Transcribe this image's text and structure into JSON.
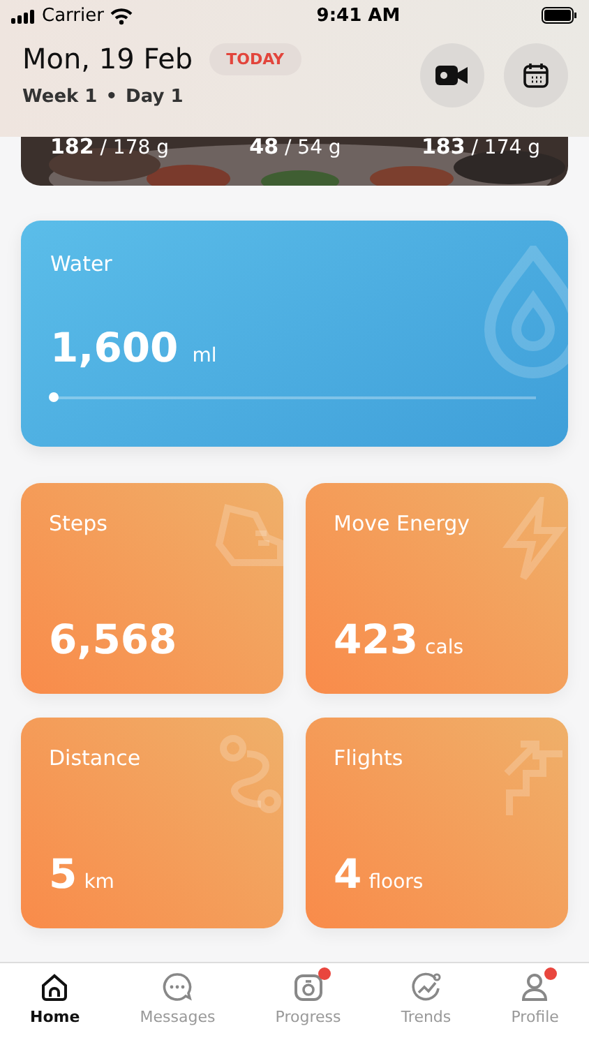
{
  "status_bar": {
    "carrier": "Carrier",
    "time": "9:41 AM"
  },
  "header": {
    "date": "Mon, 19 Feb",
    "badge": "TODAY",
    "week": "Week 1",
    "separator": "•",
    "day": "Day 1"
  },
  "meal_card": {
    "kind": "picture",
    "macros": [
      {
        "value": "182",
        "target": "/ 178 g"
      },
      {
        "value": "48",
        "target": "/ 54 g"
      },
      {
        "value": "183",
        "target": "/ 174 g"
      }
    ]
  },
  "water": {
    "title": "Water",
    "value": "1,600",
    "unit": "ml",
    "level": 0
  },
  "tiles": [
    {
      "kind": "steps",
      "title": "Steps",
      "value": "6,568"
    },
    {
      "kind": "energy",
      "title": "Move Energy",
      "value": "423",
      "unit": "cals"
    },
    {
      "kind": "distance",
      "title": "Distance",
      "value": "5",
      "unit": "km"
    },
    {
      "kind": "flights",
      "title": "Flights",
      "value": "4",
      "unit": "floors"
    }
  ],
  "tab_bar": [
    {
      "kind": "home",
      "label": "Home",
      "selected": true,
      "badge": false
    },
    {
      "kind": "messages",
      "label": "Messages",
      "selected": false,
      "badge": false
    },
    {
      "kind": "progress",
      "label": "Progress",
      "selected": false,
      "badge": true
    },
    {
      "kind": "trends",
      "label": "Trends",
      "selected": false,
      "badge": false
    },
    {
      "kind": "profile",
      "label": "Profile",
      "selected": false,
      "badge": true
    }
  ]
}
